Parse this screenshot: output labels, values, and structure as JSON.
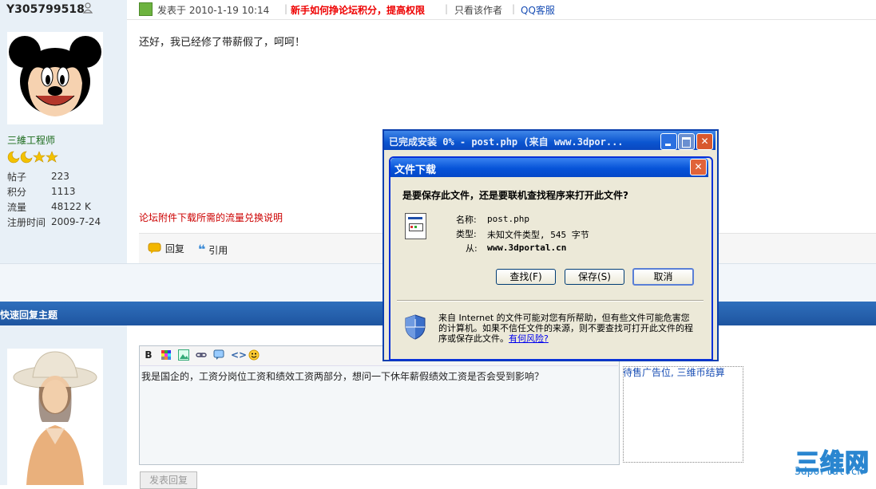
{
  "post": {
    "username": "Y305799518",
    "rank": "三維工程师",
    "stats": [
      {
        "label": "帖子",
        "value": "223"
      },
      {
        "label": "积分",
        "value": "1113"
      },
      {
        "label": "流量",
        "value": "48122 K"
      },
      {
        "label": "注册时间",
        "value": "2009-7-24"
      }
    ],
    "posted_at": "发表于 2010-1-19 10:14",
    "hot_link": "新手如何挣论坛积分，提高权限",
    "only_author": "只看该作者",
    "qq_service": "QQ客服",
    "body": "还好，我已经修了带薪假了，呵呵！",
    "attach_note": "论坛附件下载所需的流量兑换说明",
    "reply_label": "回复",
    "quote_label": "引用"
  },
  "quick_reply": {
    "title": "快速回复主题",
    "editor_text": "我是国企的，工资分岗位工资和绩效工资两部分，想问一下休年薪假绩效工资是否会受到影响？",
    "ad_text": "待售广告位, 三维币结算",
    "submit_label": "发表回复"
  },
  "logo": {
    "main": "三维网",
    "sub": "3dportal.cn"
  },
  "download_window": {
    "title": "已完成安装  0% - post.php (来自 www.3dpor..."
  },
  "file_dialog": {
    "title": "文件下载",
    "question": "是要保存此文件，还是要联机查找程序来打开此文件?",
    "name_label": "名称:",
    "name_value": "post.php",
    "type_label": "类型:",
    "type_value": "未知文件类型, 545 字节",
    "from_label": "从:",
    "from_value": "www.3dportal.cn",
    "find_button": "查找(F)",
    "save_button": "保存(S)",
    "cancel_button": "取消",
    "warning": "来自 Internet 的文件可能对您有所帮助，但有些文件可能危害您的计算机。如果不信任文件的来源，则不要查找可打开此文件的程序或保存此文件。",
    "risk_link": "有何风险?"
  }
}
